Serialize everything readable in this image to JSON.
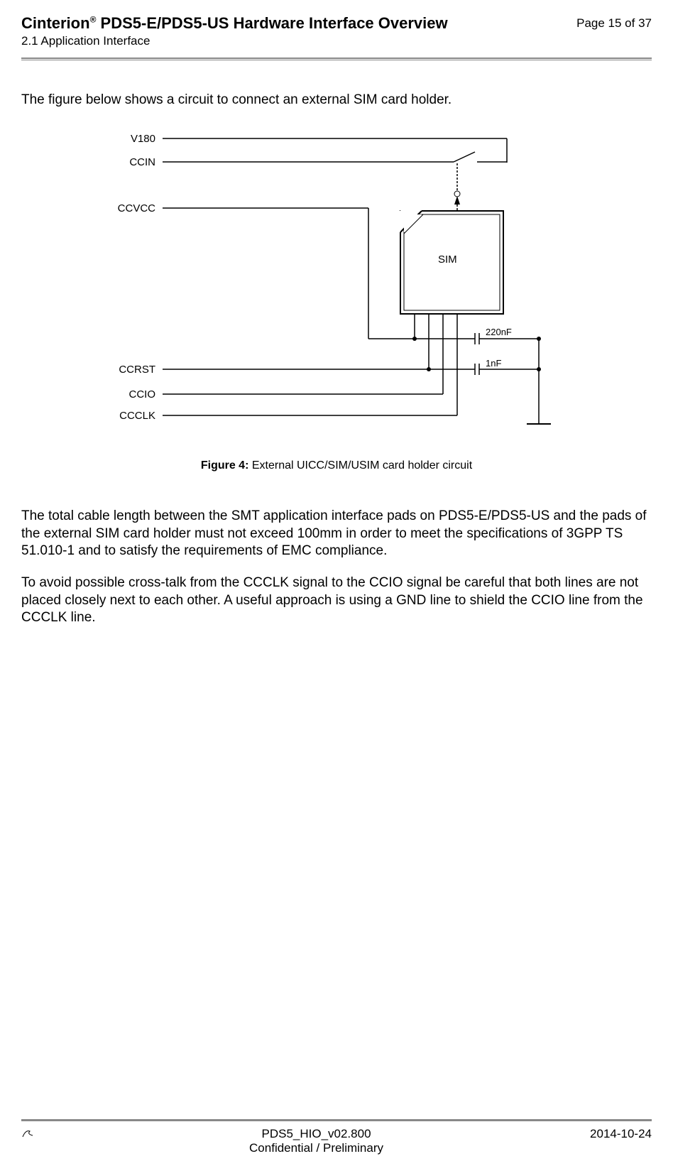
{
  "header": {
    "title_prefix": "Cinterion",
    "title_suffix": " PDS5-E/PDS5-US Hardware Interface Overview",
    "subtitle": "2.1 Application Interface",
    "page_indicator": "Page 15 of 37"
  },
  "content": {
    "intro": "The figure below shows a circuit to connect an external SIM card holder.",
    "para1": "The total cable length between the SMT application interface pads on PDS5-E/PDS5-US and the pads of the external SIM card holder must not exceed 100mm in order to meet the specifi­cations of 3GPP TS 51.010-1 and to satisfy the requirements of EMC compliance.",
    "para2": "To avoid possible cross-talk from the CCCLK signal to the CCIO signal be careful that both lines are not placed closely next to each other. A useful approach is using a GND line to shield the CCIO line from the CCCLK line."
  },
  "figure": {
    "caption_num": "Figure 4:",
    "caption_text": "  External UICC/SIM/USIM card holder circuit",
    "signals": {
      "v180": "V180",
      "ccin": "CCIN",
      "ccvcc": "CCVCC",
      "ccrst": "CCRST",
      "ccio": "CCIO",
      "ccclk": "CCCLK"
    },
    "sim_block": "SIM",
    "cap1": "220nF",
    "cap2": "1nF"
  },
  "footer": {
    "doc_id": "PDS5_HIO_v02.800",
    "confidentiality": "Confidential / Preliminary",
    "date": "2014-10-24"
  }
}
